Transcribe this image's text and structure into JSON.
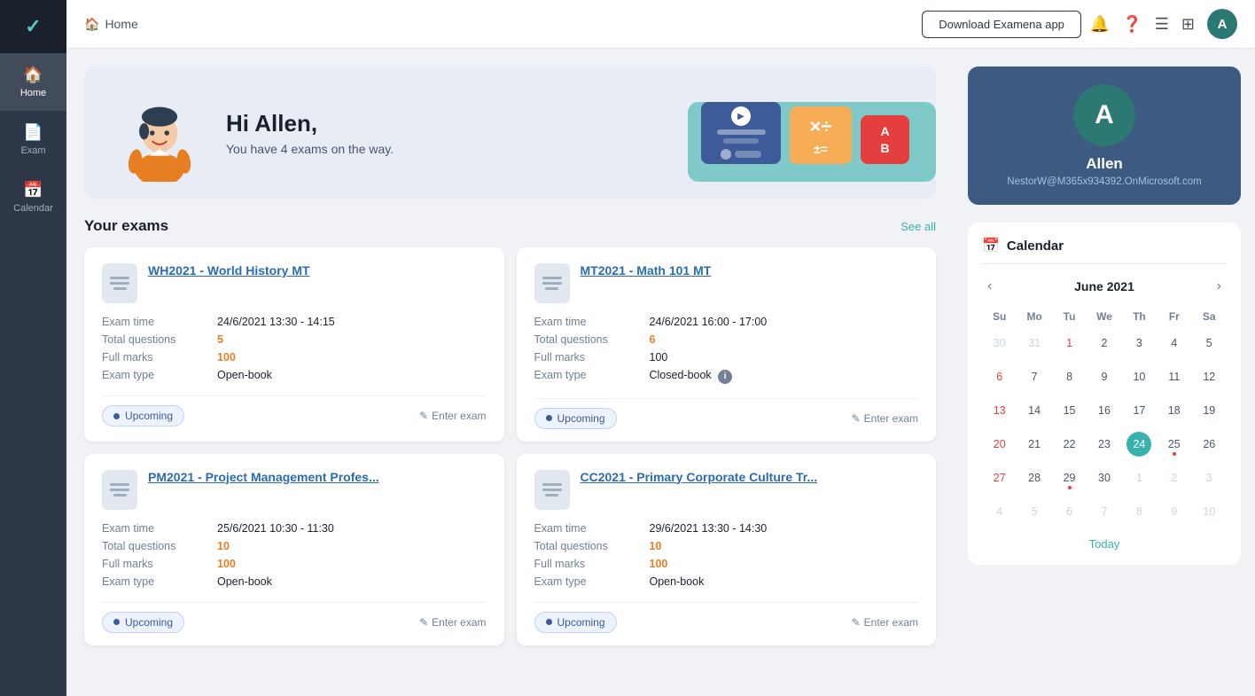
{
  "sidebar": {
    "logo": "✓",
    "items": [
      {
        "id": "home",
        "label": "Home",
        "icon": "🏠",
        "active": true
      },
      {
        "id": "exam",
        "label": "Exam",
        "icon": "📄"
      },
      {
        "id": "calendar",
        "label": "Calendar",
        "icon": "📅"
      }
    ]
  },
  "topbar": {
    "breadcrumb_icon": "🏠",
    "breadcrumb_text": "Home",
    "download_btn": "Download Examena app",
    "user_initial": "A"
  },
  "banner": {
    "greeting": "Hi Allen,",
    "subtitle": "You have 4 exams on the way."
  },
  "exams_section": {
    "title": "Your exams",
    "see_all": "See all",
    "cards": [
      {
        "id": "wh2021",
        "title": "WH2021 - World History MT",
        "exam_time_label": "Exam time",
        "exam_time_value": "24/6/2021 13:30 - 14:15",
        "total_q_label": "Total questions",
        "total_q_value": "5",
        "full_marks_label": "Full marks",
        "full_marks_value": "100",
        "exam_type_label": "Exam type",
        "exam_type_value": "Open-book",
        "status": "Upcoming",
        "enter_exam": "Enter exam"
      },
      {
        "id": "mt2021",
        "title": "MT2021 - Math 101 MT",
        "exam_time_label": "Exam time",
        "exam_time_value": "24/6/2021 16:00 - 17:00",
        "total_q_label": "Total questions",
        "total_q_value": "6",
        "full_marks_label": "Full marks",
        "full_marks_value": "100",
        "exam_type_label": "Exam type",
        "exam_type_value": "Closed-book",
        "has_info": true,
        "status": "Upcoming",
        "enter_exam": "Enter exam"
      },
      {
        "id": "pm2021",
        "title": "PM2021 - Project Management Profes...",
        "exam_time_label": "Exam time",
        "exam_time_value": "25/6/2021 10:30 - 11:30",
        "total_q_label": "Total questions",
        "total_q_value": "10",
        "full_marks_label": "Full marks",
        "full_marks_value": "100",
        "exam_type_label": "Exam type",
        "exam_type_value": "Open-book",
        "status": "Upcoming",
        "enter_exam": "Enter exam"
      },
      {
        "id": "cc2021",
        "title": "CC2021 - Primary Corporate Culture Tr...",
        "exam_time_label": "Exam time",
        "exam_time_value": "29/6/2021 13:30 - 14:30",
        "total_q_label": "Total questions",
        "total_q_value": "10",
        "full_marks_label": "Full marks",
        "full_marks_value": "100",
        "exam_type_label": "Exam type",
        "exam_type_value": "Open-book",
        "status": "Upcoming",
        "enter_exam": "Enter exam"
      }
    ]
  },
  "profile": {
    "initial": "A",
    "name": "Allen",
    "email": "NestorW@M365x934392.OnMicrosoft.com"
  },
  "calendar": {
    "title": "Calendar",
    "month": "June 2021",
    "days_of_week": [
      "Su",
      "Mo",
      "Tu",
      "We",
      "Th",
      "Fr",
      "Sa"
    ],
    "today_label": "Today",
    "today_day": 24,
    "weeks": [
      [
        {
          "day": 30,
          "other": true,
          "sunday": true
        },
        {
          "day": 31,
          "other": true
        },
        {
          "day": 1,
          "sunday": false,
          "red": true
        },
        {
          "day": 2
        },
        {
          "day": 3
        },
        {
          "day": 4
        },
        {
          "day": 5
        }
      ],
      [
        {
          "day": 6,
          "sunday": true,
          "red": true
        },
        {
          "day": 7
        },
        {
          "day": 8
        },
        {
          "day": 9
        },
        {
          "day": 10
        },
        {
          "day": 11
        },
        {
          "day": 12
        }
      ],
      [
        {
          "day": 13,
          "sunday": true,
          "red": true
        },
        {
          "day": 14
        },
        {
          "day": 15
        },
        {
          "day": 16
        },
        {
          "day": 17
        },
        {
          "day": 18
        },
        {
          "day": 19
        }
      ],
      [
        {
          "day": 20,
          "sunday": true,
          "red": true
        },
        {
          "day": 21
        },
        {
          "day": 22
        },
        {
          "day": 23
        },
        {
          "day": 24,
          "today": true
        },
        {
          "day": 25,
          "dot": true
        },
        {
          "day": 26
        }
      ],
      [
        {
          "day": 27,
          "sunday": true,
          "red": true
        },
        {
          "day": 28
        },
        {
          "day": 29,
          "dot": true
        },
        {
          "day": 30
        },
        {
          "day": 1,
          "other": true
        },
        {
          "day": 2,
          "other": true
        },
        {
          "day": 3,
          "other": true
        }
      ],
      [
        {
          "day": 4,
          "other": true,
          "sunday": true
        },
        {
          "day": 5,
          "other": true
        },
        {
          "day": 6,
          "other": true
        },
        {
          "day": 7,
          "other": true
        },
        {
          "day": 8,
          "other": true
        },
        {
          "day": 9,
          "other": true
        },
        {
          "day": 10,
          "other": true
        }
      ]
    ]
  }
}
